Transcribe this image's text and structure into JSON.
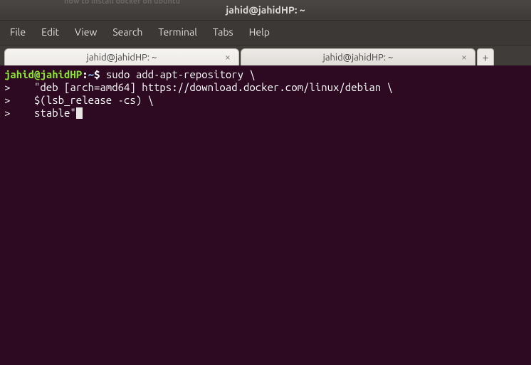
{
  "window": {
    "title": "jahid@jahidHP: ~",
    "background_tab_hint": "how to install docker on ubuntu"
  },
  "menubar": {
    "items": [
      "File",
      "Edit",
      "View",
      "Search",
      "Terminal",
      "Tabs",
      "Help"
    ]
  },
  "tabs": [
    {
      "label": "jahid@jahidHP: ~",
      "active": true
    },
    {
      "label": "jahid@jahidHP: ~",
      "active": false
    }
  ],
  "prompt": {
    "user": "jahid",
    "at": "@",
    "host": "jahidHP",
    "colon": ":",
    "path": "~",
    "symbol": "$"
  },
  "lines": {
    "l1_cmd": " sudo add-apt-repository \\",
    "l2": ">    \"deb [arch=amd64] https://download.docker.com/linux/debian \\",
    "l3": ">    $(lsb_release -cs) \\",
    "l4": ">    stable\""
  }
}
